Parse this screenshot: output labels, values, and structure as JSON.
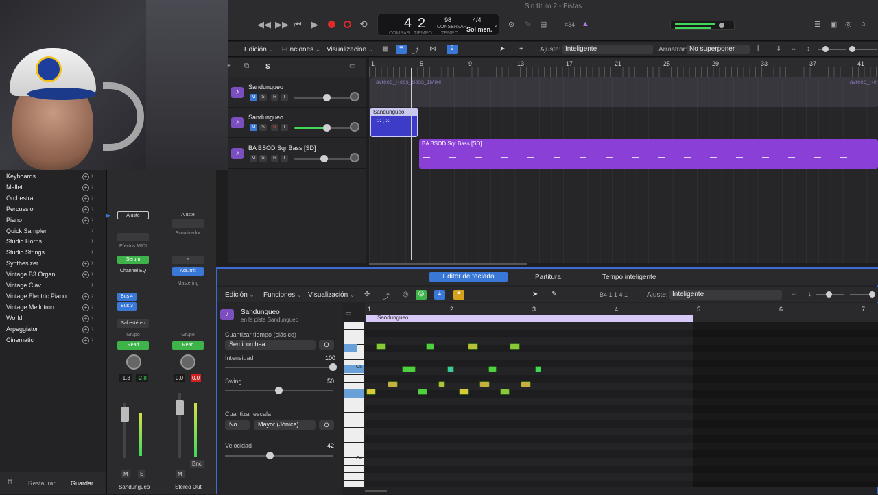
{
  "window_title": "Sin título 2 - Pistas",
  "transport": {
    "bar": "4",
    "beat": "2",
    "bar_label": "COMPÁS",
    "beat_label": "TIEMPO",
    "tempo": "98",
    "tempo_mode": "CONSERVAR",
    "tempo_label": "TEMPO",
    "time_sig": "4/4",
    "key": "Sol men.",
    "count_in": "⌗34"
  },
  "tracks_menu": {
    "edit": "Edición",
    "functions": "Funciones",
    "view": "Visualización",
    "snap_label": "Ajuste:",
    "snap_value": "Inteligente",
    "drag_label": "Arrastrar:",
    "drag_value": "No superponer"
  },
  "ruler_marks": [
    "1",
    "5",
    "9",
    "13",
    "17",
    "21",
    "25",
    "29",
    "33",
    "37",
    "41"
  ],
  "tracks": [
    {
      "name": "Sandungueo",
      "m": "M",
      "s": "S",
      "r": "R",
      "i": "I"
    },
    {
      "name": "Sandungueo",
      "m": "M",
      "s": "S",
      "r": "R",
      "i": "I"
    },
    {
      "name": "BA BSOD Sqr Bass [SD]",
      "m": "M",
      "s": "S",
      "r": "R",
      "i": "I"
    }
  ],
  "regions": {
    "ghost_left": "Tavreed_Rees_Bass_1Mike",
    "ghost_right": "Tavreed_Re",
    "sandungueo": "Sandungueo",
    "bass": "BA BSOD Sqr Bass [SD]"
  },
  "library": {
    "items": [
      {
        "label": "Keyboards",
        "plus": true
      },
      {
        "label": "Mallet",
        "plus": true
      },
      {
        "label": "Orchestral",
        "plus": true
      },
      {
        "label": "Percussion",
        "plus": true
      },
      {
        "label": "Piano",
        "plus": true
      },
      {
        "label": "Quick Sampler",
        "plus": false
      },
      {
        "label": "Studio Horns",
        "plus": false
      },
      {
        "label": "Studio Strings",
        "plus": false
      },
      {
        "label": "Synthesizer",
        "plus": true
      },
      {
        "label": "Vintage B3 Organ",
        "plus": true
      },
      {
        "label": "Vintage Clav",
        "plus": false
      },
      {
        "label": "Vintage Electric Piano",
        "plus": true
      },
      {
        "label": "Vintage Mellotron",
        "plus": true
      },
      {
        "label": "World",
        "plus": true
      },
      {
        "label": "Arpeggiator",
        "plus": true
      },
      {
        "label": "Cinematic",
        "plus": true
      }
    ],
    "restore": "Restaurar",
    "save": "Guardar..."
  },
  "mixer": {
    "strip1": {
      "setting": "Ajuste",
      "midi_fx": "Efectos MIDI",
      "instrument": "Serum",
      "eq": "Channel EQ",
      "bus1": "Bus 4",
      "bus2": "Bus 3",
      "output": "Sal estéreo",
      "group": "Grupo",
      "automation": "Read",
      "vol": "-1.3",
      "peak": "-2.8",
      "m": "M",
      "s": "S",
      "name": "Sandungueo"
    },
    "strip2": {
      "setting": "Ajuste",
      "eq": "Ecualizador",
      "plugin": "AdLimit",
      "mastering": "Mastering",
      "group": "Grupo",
      "automation": "Read",
      "vol": "0.0",
      "peak": "0.0",
      "m": "M",
      "bnc": "Bnc",
      "name": "Stereo Out"
    }
  },
  "editor": {
    "tabs": [
      "Editor de teclado",
      "Partitura",
      "Tempo inteligente"
    ],
    "edit": "Edición",
    "functions": "Funciones",
    "view": "Visualización",
    "position": "B4  1 1 4 1",
    "snap_label": "Ajuste:",
    "snap_value": "Inteligente",
    "region_name": "Sandungueo",
    "region_sub": "en la pista Sandungueo",
    "quantize_label": "Cuantizar tiempo (clásico)",
    "quantize_value": "Semicorchea",
    "q": "Q",
    "intensity_label": "Intensidad",
    "intensity_value": "100",
    "swing_label": "Swing",
    "swing_value": "50",
    "scale_label": "Cuantizar escala",
    "scale_no": "No",
    "scale_value": "Mayor (Jónica)",
    "velocity_label": "Velocidad",
    "velocity_value": "42",
    "ruler": [
      "1",
      "2",
      "3",
      "4",
      "5",
      "6",
      "7"
    ],
    "key_c5": "C5",
    "key_c4": "C4",
    "region_label": "Sandungueo"
  }
}
